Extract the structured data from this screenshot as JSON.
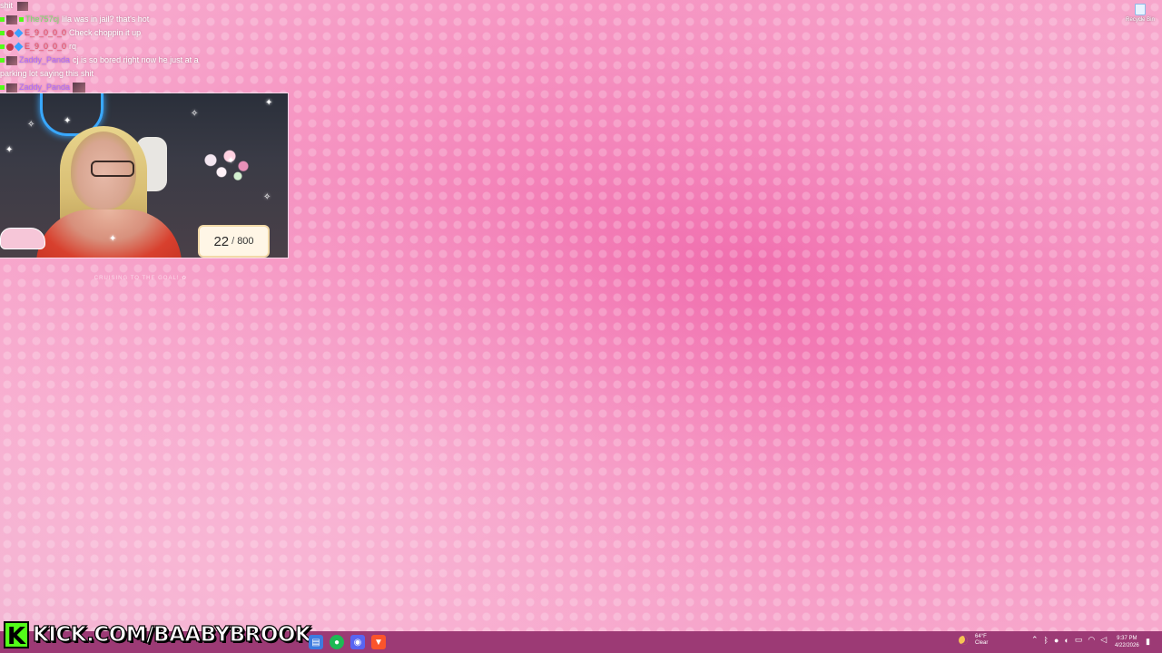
{
  "chat": {
    "top_fragment": "shit",
    "messages": [
      {
        "user": "The757cj",
        "text": "lila was in jail? that's hot",
        "user_color": "#7ee06b"
      },
      {
        "user": "E_9_0_0_0",
        "text": "Check choppin it up",
        "user_color": "#e8475e"
      },
      {
        "user": "E_9_0_0_0",
        "text": "rq",
        "user_color": "#e8475e"
      },
      {
        "user": "Zaddy_Panda",
        "text": "cj is so bored right now he just at a",
        "user_color": "#b06bff"
      },
      {
        "user": "",
        "text": "parking lot saying this shit",
        "user_color": "#ffffff"
      },
      {
        "user": "Zaddy_Panda",
        "text": "",
        "user_color": "#b06bff"
      }
    ]
  },
  "goal": {
    "current": "22",
    "separator": "/",
    "target": "800",
    "caption": "CRUISING TO THE GOAL! ✿"
  },
  "desktop": {
    "recycle_bin_label": "Recycle Bin"
  },
  "overlay": {
    "kick_letter": "K",
    "kick_url": "KICK.COM/BAABYBROOK"
  },
  "taskbar": {
    "apps": [
      {
        "icon": "file-explorer-icon",
        "color": "#3d7be0",
        "glyph": "▤"
      },
      {
        "icon": "spotify-icon",
        "color": "#1db954",
        "glyph": "●"
      },
      {
        "icon": "discord-icon",
        "color": "#5865f2",
        "glyph": "◉"
      },
      {
        "icon": "brave-icon",
        "color": "#fb542b",
        "glyph": "▼"
      }
    ],
    "weather_temp": "64°F",
    "weather_desc": "Clear",
    "time": "9:37 PM",
    "date": "4/22/2026"
  }
}
